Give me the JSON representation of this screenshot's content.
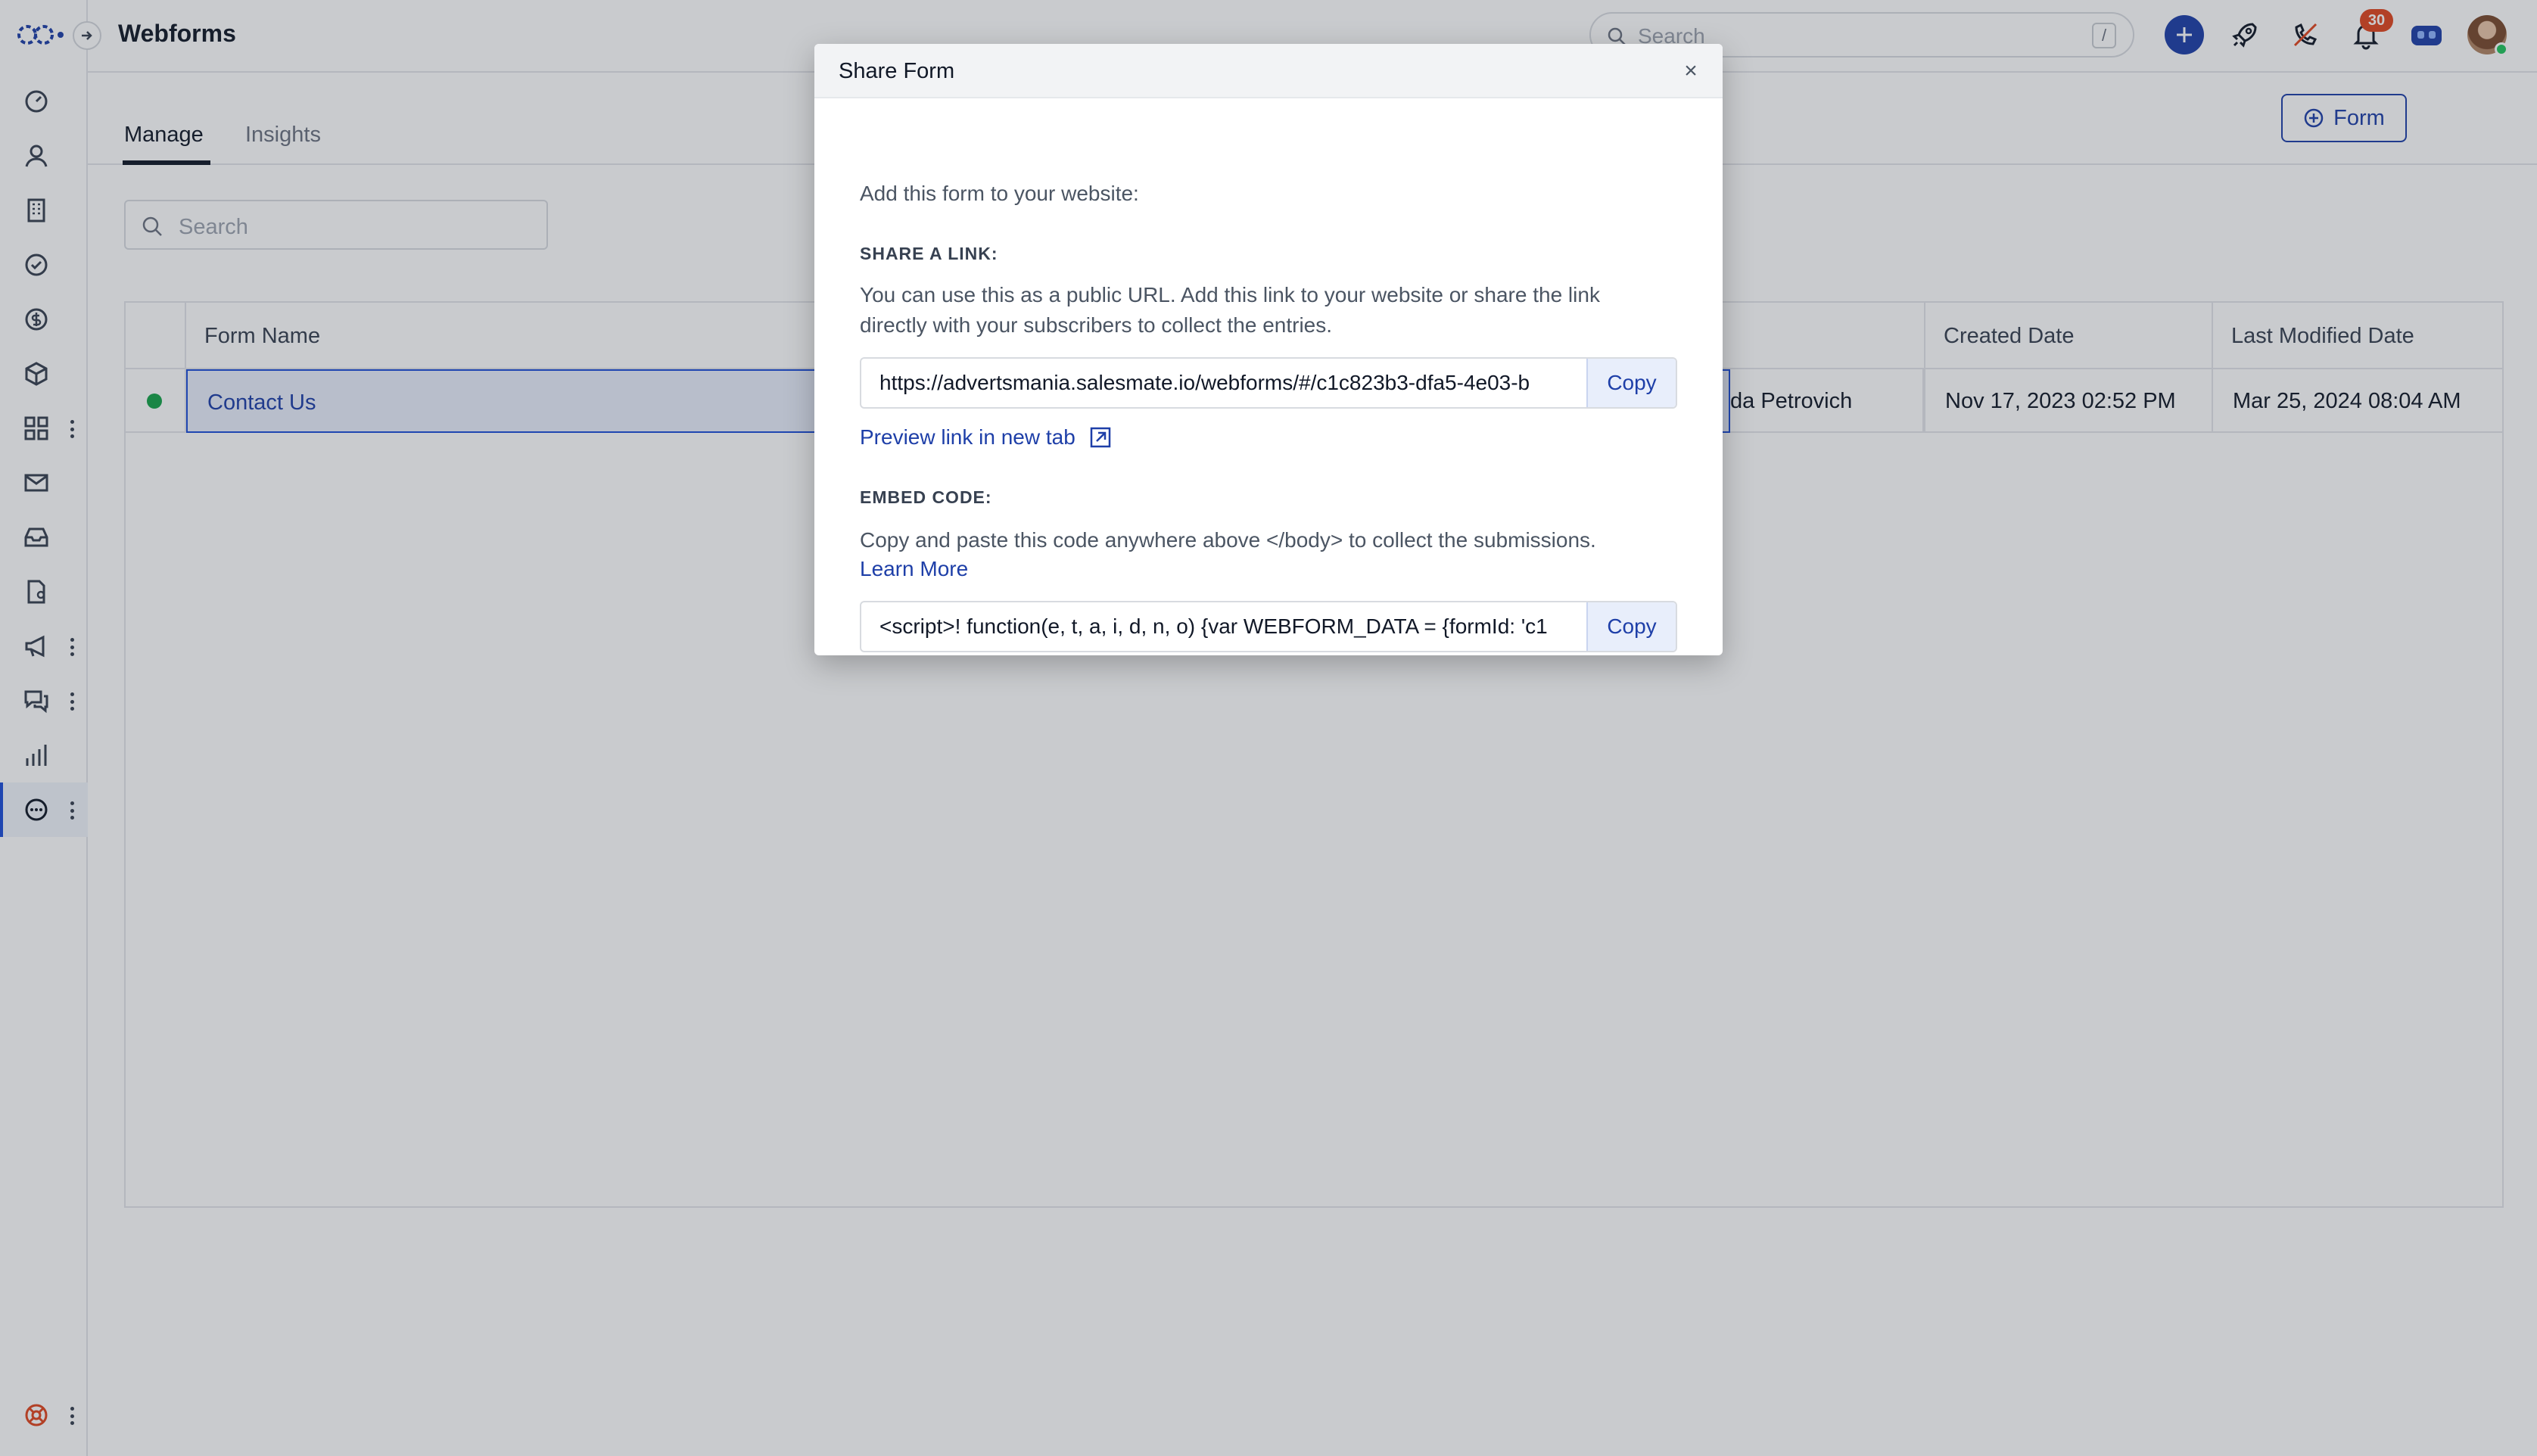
{
  "header": {
    "title": "Webforms",
    "search_placeholder": "Search",
    "search_shortcut": "/",
    "notification_count": "30"
  },
  "tabs": [
    {
      "label": "Manage"
    },
    {
      "label": "Insights"
    }
  ],
  "toolbar": {
    "add_form_label": "Form",
    "list_search_placeholder": "Search"
  },
  "table": {
    "columns": [
      "Form Name",
      "Created Date",
      "Last Modified Date"
    ],
    "rows": [
      {
        "name": "Contact Us",
        "owner_partial": "da Petrovich",
        "created": "Nov 17, 2023 02:52 PM",
        "modified": "Mar 25, 2024 08:04 AM"
      }
    ]
  },
  "modal": {
    "title": "Share Form",
    "close_label": "×",
    "intro": "Add this form to your website:",
    "share_heading": "SHARE A LINK:",
    "share_desc_1": "You can use this as a public URL. Add this link to your website or share the link",
    "share_desc_2": "directly with your subscribers to collect the entries.",
    "share_url": "https://advertsmania.salesmate.io/webforms/#/c1c823b3-dfa5-4e03-b",
    "copy_label": "Copy",
    "preview_link": "Preview link in new tab",
    "embed_heading": "EMBED CODE:",
    "embed_desc": "Copy and paste this code anywhere above </body> to collect the submissions.",
    "learn_more": "Learn More",
    "embed_code": "<script>! function(e, t, a, i, d, n, o) {var WEBFORM_DATA = {formId: 'c1"
  },
  "colors": {
    "accent": "#1e3fa8",
    "status_active": "#16a34a",
    "badge": "#e0461f"
  }
}
